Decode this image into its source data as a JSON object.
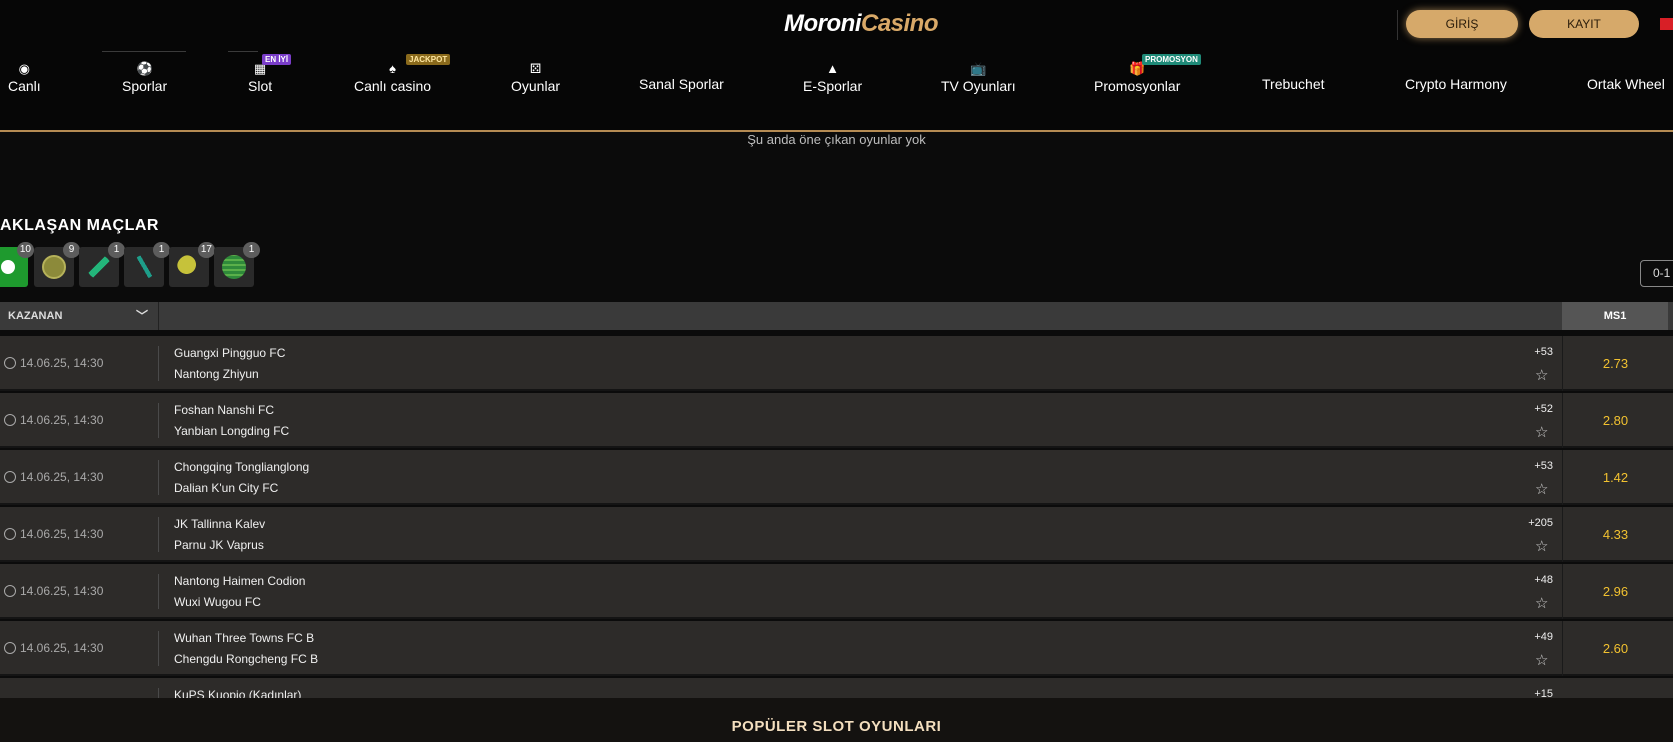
{
  "header": {
    "logo_white": "Moroni",
    "logo_gold": "Casino",
    "login_label": "GİRİŞ",
    "register_label": "KAYIT"
  },
  "nav": [
    {
      "label": "Canlı",
      "icon": "live-icon",
      "glyph": "◉",
      "badge": ""
    },
    {
      "label": "Sporlar",
      "icon": "soccer-ball-icon",
      "glyph": "⚽",
      "badge": ""
    },
    {
      "label": "Slot",
      "icon": "slot-icon",
      "glyph": "▦",
      "badge": "EN İYİ"
    },
    {
      "label": "Canlı casino",
      "icon": "dealer-icon",
      "glyph": "♠",
      "badge": "JACKPOT"
    },
    {
      "label": "Oyunlar",
      "icon": "dice-icon",
      "glyph": "⚄",
      "badge": ""
    },
    {
      "label": "Sanal Sporlar",
      "icon": "",
      "glyph": "",
      "badge": ""
    },
    {
      "label": "E-Sporlar",
      "icon": "esports-icon",
      "glyph": "▲",
      "badge": ""
    },
    {
      "label": "TV Oyunları",
      "icon": "tv-icon",
      "glyph": "📺",
      "badge": ""
    },
    {
      "label": "Promosyonlar",
      "icon": "gift-icon",
      "glyph": "🎁",
      "badge": "PROMOSYON"
    },
    {
      "label": "Trebuchet",
      "icon": "",
      "glyph": "",
      "badge": ""
    },
    {
      "label": "Crypto Harmony",
      "icon": "",
      "glyph": "",
      "badge": ""
    },
    {
      "label": "Ortak Wheel",
      "icon": "",
      "glyph": "",
      "badge": ""
    }
  ],
  "featured": {
    "empty_text": "Şu anda öne çıkan oyunlar yok"
  },
  "upcoming": {
    "title": "AKLAŞAN MAÇLAR",
    "sports": [
      {
        "icon": "soccer-icon",
        "count": "10",
        "active": true
      },
      {
        "icon": "tennis-icon",
        "count": "9",
        "active": false
      },
      {
        "icon": "cricket-icon",
        "count": "1",
        "active": false
      },
      {
        "icon": "ice-hockey-icon",
        "count": "1",
        "active": false
      },
      {
        "icon": "table-tennis-icon",
        "count": "17",
        "active": false
      },
      {
        "icon": "volleyball-icon",
        "count": "1",
        "active": false
      }
    ],
    "range_label": "0-1",
    "market_label": "KAZANAN",
    "odds_header": "MS1",
    "matches": [
      {
        "time": "14.06.25, 14:30",
        "team1": "Guangxi Pingguo FC",
        "team2": "Nantong Zhiyun",
        "more": "+53",
        "odd": "2.73"
      },
      {
        "time": "14.06.25, 14:30",
        "team1": "Foshan Nanshi FC",
        "team2": "Yanbian Longding FC",
        "more": "+52",
        "odd": "2.80"
      },
      {
        "time": "14.06.25, 14:30",
        "team1": "Chongqing Tonglianglong",
        "team2": "Dalian K'un City FC",
        "more": "+53",
        "odd": "1.42"
      },
      {
        "time": "14.06.25, 14:30",
        "team1": "JK Tallinna Kalev",
        "team2": "Parnu JK Vaprus",
        "more": "+205",
        "odd": "4.33"
      },
      {
        "time": "14.06.25, 14:30",
        "team1": "Nantong Haimen Codion",
        "team2": "Wuxi Wugou FC",
        "more": "+48",
        "odd": "2.96"
      },
      {
        "time": "14.06.25, 14:30",
        "team1": "Wuhan Three Towns FC B",
        "team2": "Chengdu Rongcheng FC B",
        "more": "+49",
        "odd": "2.60"
      },
      {
        "time": "",
        "team1": "KuPS Kuopio (Kadınlar)",
        "team2": "",
        "more": "+15",
        "odd": ""
      }
    ]
  },
  "popular_slots": {
    "title": "POPÜLER SLOT OYUNLARI"
  },
  "colors": {
    "accent_gold": "#d6a96a",
    "odd_yellow": "#f2c230",
    "active_green": "#1e9a2e"
  }
}
